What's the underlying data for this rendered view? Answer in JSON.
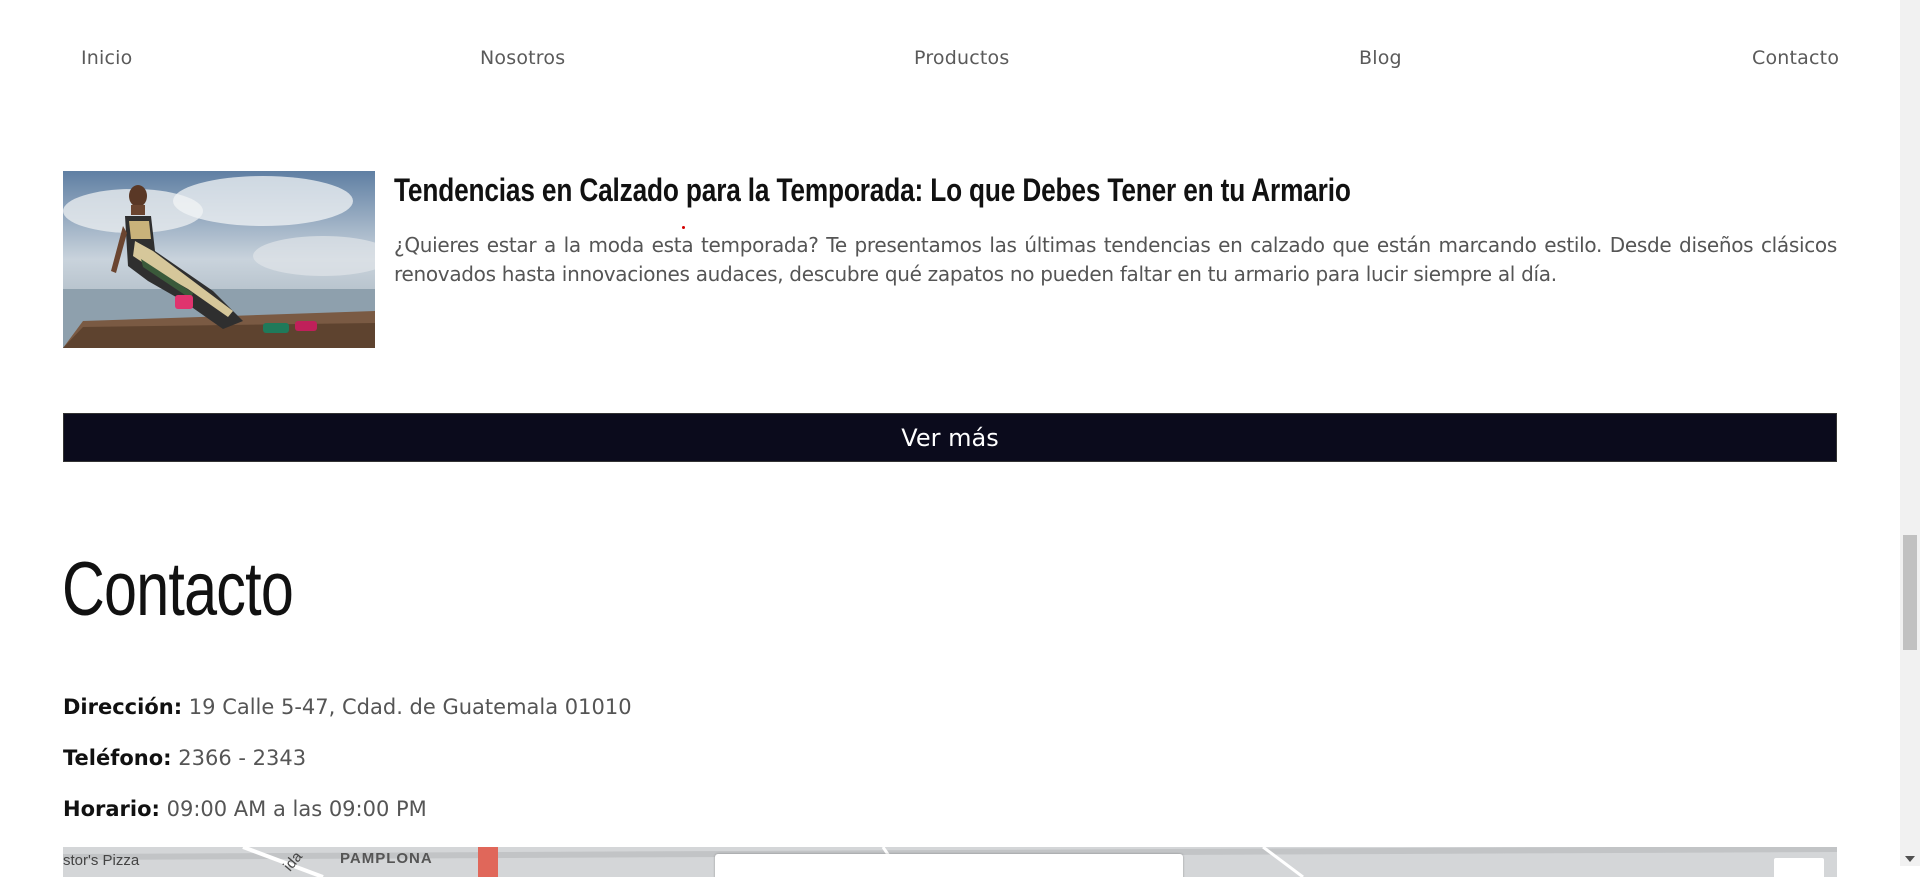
{
  "nav": {
    "items": [
      {
        "label": "Inicio"
      },
      {
        "label": "Nosotros"
      },
      {
        "label": "Productos"
      },
      {
        "label": "Blog"
      },
      {
        "label": "Contacto"
      }
    ]
  },
  "post": {
    "title": "Tendencias en Calzado para la Temporada: Lo que Debes Tener en tu Armario",
    "excerpt": "¿Quieres estar a la moda esta temporada? Te presentamos las últimas tendencias en calzado que están marcando estilo. Desde diseños clásicos renovados hasta innovaciones audaces, descubre qué zapatos no pueden faltar en tu armario para lucir siempre al día.",
    "image_alt": "fashion-model-on-dock"
  },
  "more_button": {
    "label": "Ver más"
  },
  "contact": {
    "title": "Contacto",
    "address_label": "Dirección:",
    "address_value": "19 Calle 5-47, Cdad. de Guatemala 01010",
    "phone_label": "Teléfono:",
    "phone_value": "2366 - 2343",
    "hours_label": "Horario:",
    "hours_value": "09:00 AM a las 09:00 PM"
  },
  "map": {
    "place_1": "stor's Pizza",
    "place_2": "PAMPLONA",
    "place_3": "ida"
  },
  "colors": {
    "button_bg": "#0b0b1c",
    "text_dark": "#111111",
    "text_muted": "#555555"
  }
}
